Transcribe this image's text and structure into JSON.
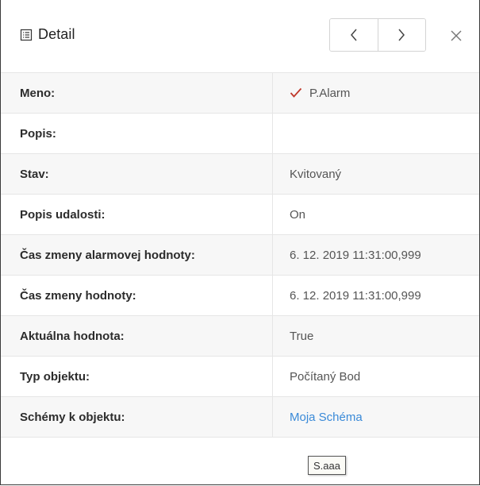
{
  "header": {
    "title": "Detail",
    "icon": "list-document-icon"
  },
  "nav": {
    "prev_icon": "chevron-left-icon",
    "next_icon": "chevron-right-icon",
    "close_icon": "close-icon"
  },
  "rows": [
    {
      "label": "Meno:",
      "value": "P.Alarm",
      "icon": "checkmark-icon",
      "icon_color": "#c0392b"
    },
    {
      "label": "Popis:",
      "value": ""
    },
    {
      "label": "Stav:",
      "value": "Kvitovaný"
    },
    {
      "label": "Popis udalosti:",
      "value": "On"
    },
    {
      "label": "Čas zmeny alarmovej hodnoty:",
      "value": "6. 12. 2019 11:31:00,999"
    },
    {
      "label": "Čas zmeny hodnoty:",
      "value": "6. 12. 2019 11:31:00,999"
    },
    {
      "label": "Aktuálna hodnota:",
      "value": "True"
    },
    {
      "label": "Typ objektu:",
      "value": "Počítaný Bod"
    },
    {
      "label": "Schémy k objektu:",
      "value": "Moja Schéma",
      "link": true,
      "link_color": "#3a8ad8"
    }
  ],
  "tooltip": {
    "text": "S.aaa"
  }
}
